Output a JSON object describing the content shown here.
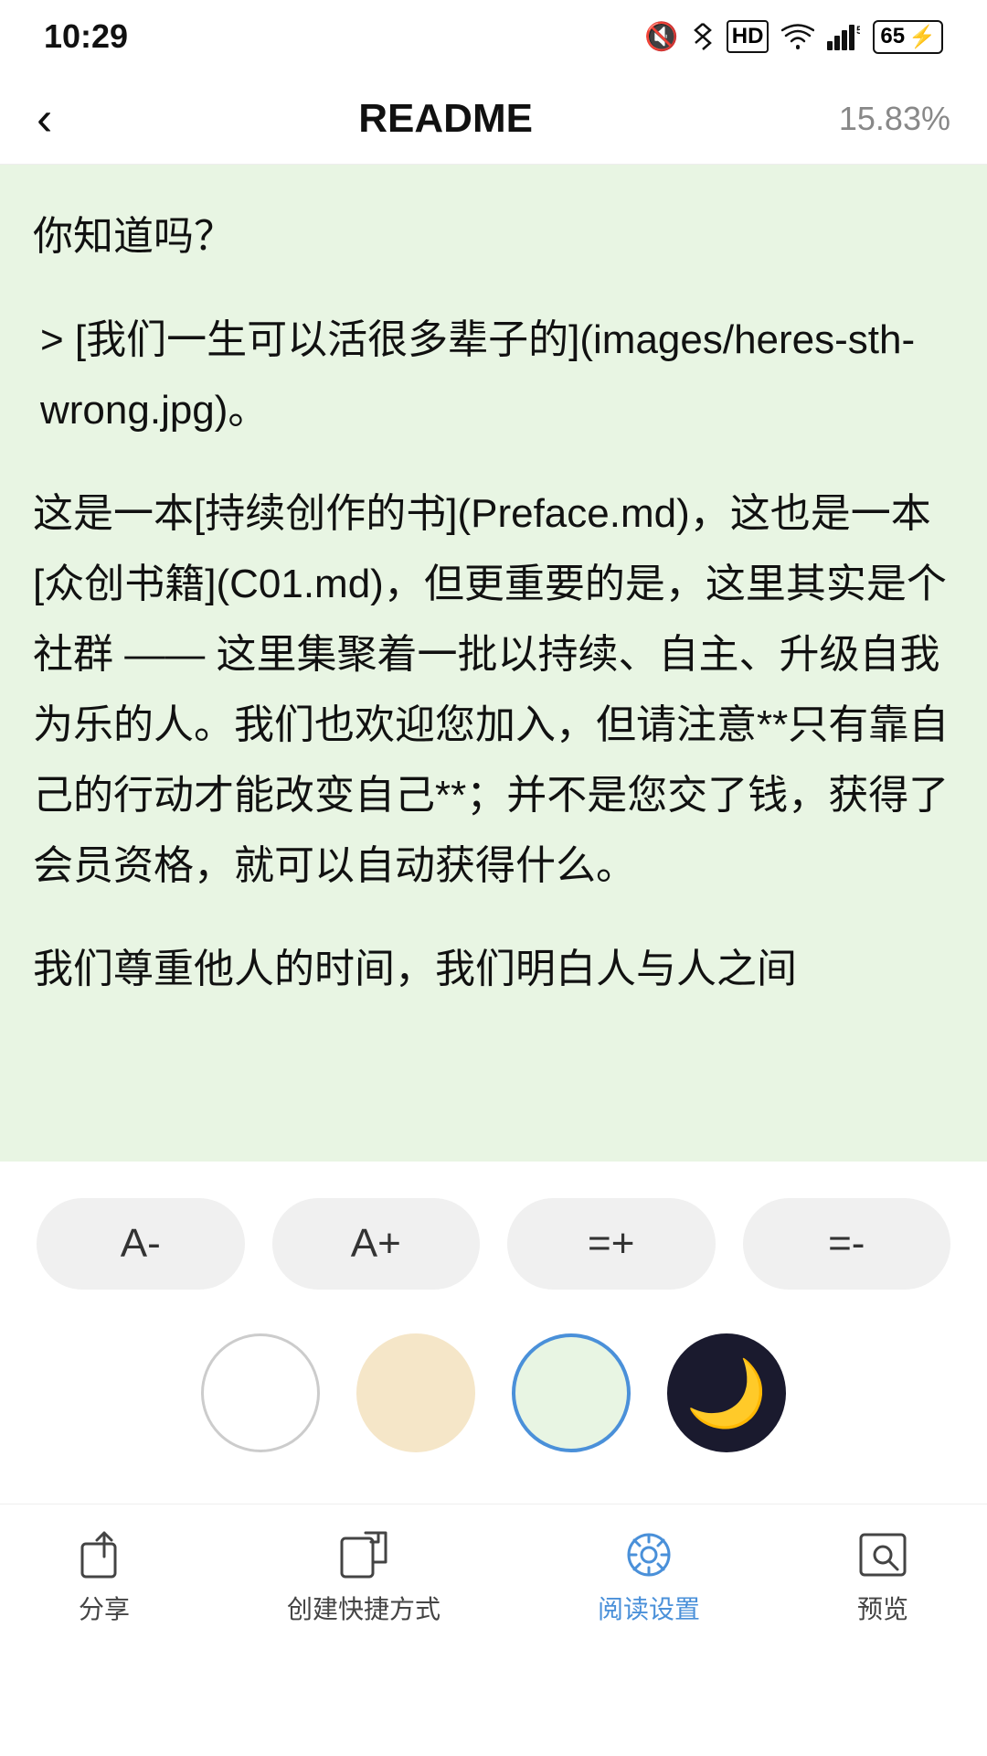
{
  "statusBar": {
    "time": "10:29",
    "icons": [
      "mute",
      "bluetooth",
      "hd",
      "wifi",
      "signal",
      "battery"
    ],
    "batteryLevel": "65"
  },
  "header": {
    "backLabel": "‹",
    "title": "README",
    "progress": "15.83%"
  },
  "reading": {
    "paragraph1": "你知道吗？",
    "paragraph2": "> [我们一生可以活很多辈子的](images/heres-sth-wrong.jpg)。",
    "paragraph3": "这是一本[持续创作的书](Preface.md)，这也是一本[众创书籍](C01.md)，但更重要的是，这里其实是个社群 ——  这里集聚着一批以持续、自主、升级自我为乐的人。我们也欢迎您加入，但请注意**只有靠自己的行动才能改变自己**；并不是您交了钱，获得了会员资格，就可以自动获得什么。",
    "paragraph4": "我们尊重他人的时间，我们明白人与人之间"
  },
  "fontControls": {
    "decreaseLabel": "A-",
    "increaseLabel": "A+",
    "spacingIncLabel": "=+",
    "spacingDecLabel": "=-"
  },
  "themes": [
    {
      "id": "white",
      "label": "白色"
    },
    {
      "id": "beige",
      "label": "米色"
    },
    {
      "id": "green",
      "label": "绿色",
      "active": true
    },
    {
      "id": "dark",
      "label": "夜间"
    }
  ],
  "bottomNav": {
    "items": [
      {
        "id": "share",
        "label": "分享",
        "active": false
      },
      {
        "id": "shortcut",
        "label": "创建快捷方式",
        "active": false
      },
      {
        "id": "reading-settings",
        "label": "阅读设置",
        "active": true
      },
      {
        "id": "preview",
        "label": "预览",
        "active": false
      }
    ]
  }
}
